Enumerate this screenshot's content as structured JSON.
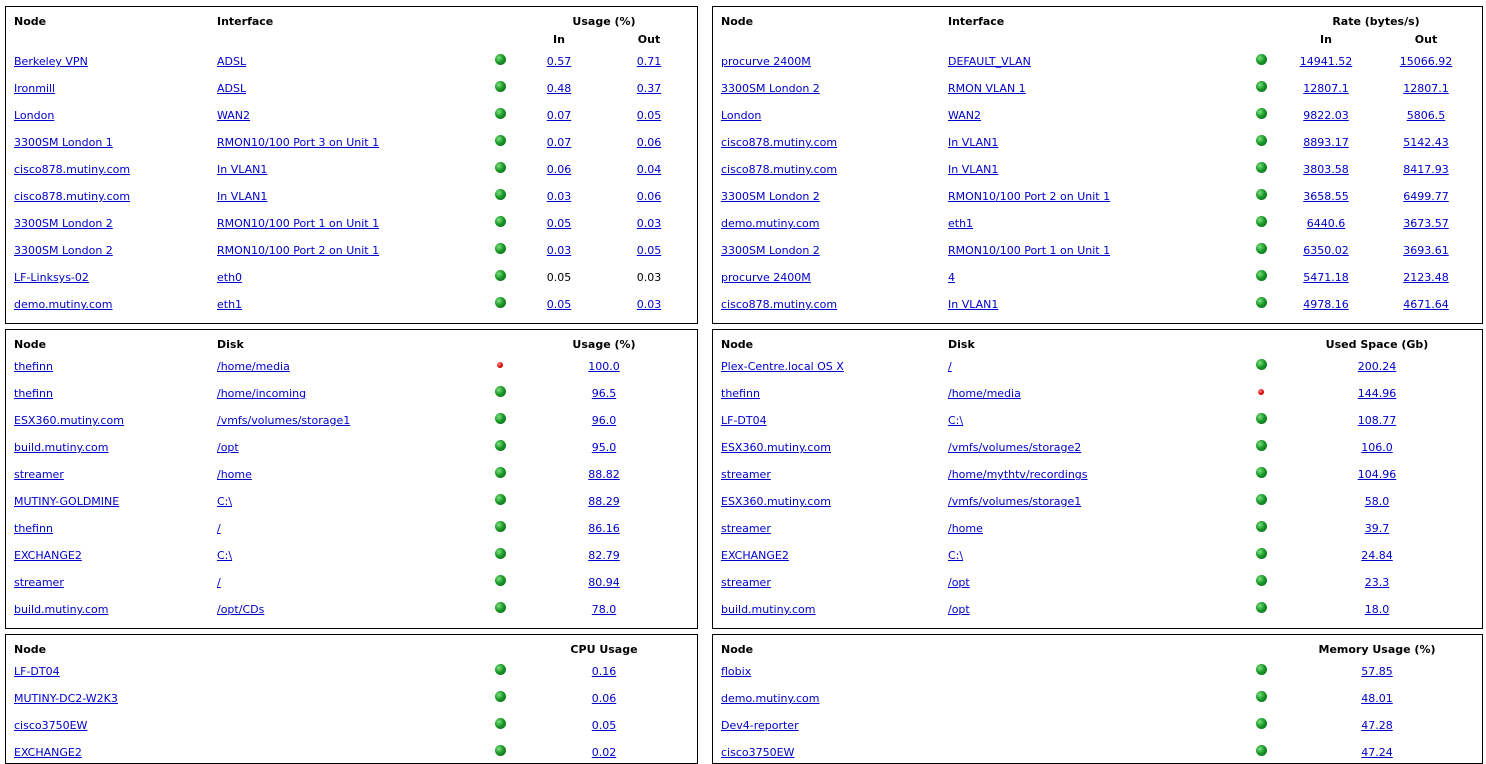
{
  "panels": [
    {
      "id": "interface-usage",
      "headers": {
        "node": "Node",
        "item": "Interface",
        "metric": "Usage (%)",
        "in": "In",
        "out": "Out"
      },
      "rows": [
        {
          "node": "Berkeley VPN",
          "item": "ADSL",
          "status": "ok",
          "in": "0.57",
          "out": "0.71",
          "linked": true
        },
        {
          "node": "Ironmill",
          "item": "ADSL",
          "status": "ok",
          "in": "0.48",
          "out": "0.37",
          "linked": true
        },
        {
          "node": "London",
          "item": "WAN2",
          "status": "ok",
          "in": "0.07",
          "out": "0.05",
          "linked": true
        },
        {
          "node": "3300SM London 1",
          "item": "RMON10/100 Port 3 on Unit 1",
          "status": "ok",
          "in": "0.07",
          "out": "0.06",
          "linked": true
        },
        {
          "node": "cisco878.mutiny.com",
          "item": "In VLAN1",
          "status": "ok",
          "in": "0.06",
          "out": "0.04",
          "linked": true
        },
        {
          "node": "cisco878.mutiny.com",
          "item": "In VLAN1",
          "status": "ok",
          "in": "0.03",
          "out": "0.06",
          "linked": true
        },
        {
          "node": "3300SM London 2",
          "item": "RMON10/100 Port 1 on Unit 1",
          "status": "ok",
          "in": "0.05",
          "out": "0.03",
          "linked": true
        },
        {
          "node": "3300SM London 2",
          "item": "RMON10/100 Port 2 on Unit 1",
          "status": "ok",
          "in": "0.03",
          "out": "0.05",
          "linked": true
        },
        {
          "node": "LF-Linksys-02",
          "item": "eth0",
          "status": "ok",
          "in": "0.05",
          "out": "0.03",
          "linked": false
        },
        {
          "node": "demo.mutiny.com",
          "item": "eth1",
          "status": "ok",
          "in": "0.05",
          "out": "0.03",
          "linked": true
        }
      ]
    },
    {
      "id": "interface-rate",
      "headers": {
        "node": "Node",
        "item": "Interface",
        "metric": "Rate (bytes/s)",
        "in": "In",
        "out": "Out"
      },
      "rows": [
        {
          "node": "procurve 2400M",
          "item": "DEFAULT_VLAN",
          "status": "ok",
          "in": "14941.52",
          "out": "15066.92",
          "linked": true
        },
        {
          "node": "3300SM London 2",
          "item": "RMON VLAN 1",
          "status": "ok",
          "in": "12807.1",
          "out": "12807.1",
          "linked": true
        },
        {
          "node": "London",
          "item": "WAN2",
          "status": "ok",
          "in": "9822.03",
          "out": "5806.5",
          "linked": true
        },
        {
          "node": "cisco878.mutiny.com",
          "item": "In VLAN1",
          "status": "ok",
          "in": "8893.17",
          "out": "5142.43",
          "linked": true
        },
        {
          "node": "cisco878.mutiny.com",
          "item": "In VLAN1",
          "status": "ok",
          "in": "3803.58",
          "out": "8417.93",
          "linked": true
        },
        {
          "node": "3300SM London 2",
          "item": "RMON10/100 Port 2 on Unit 1",
          "status": "ok",
          "in": "3658.55",
          "out": "6499.77",
          "linked": true
        },
        {
          "node": "demo.mutiny.com",
          "item": "eth1",
          "status": "ok",
          "in": "6440.6",
          "out": "3673.57",
          "linked": true
        },
        {
          "node": "3300SM London 2",
          "item": "RMON10/100 Port 1 on Unit 1",
          "status": "ok",
          "in": "6350.02",
          "out": "3693.61",
          "linked": true
        },
        {
          "node": "procurve 2400M",
          "item": "4",
          "status": "ok",
          "in": "5471.18",
          "out": "2123.48",
          "linked": true
        },
        {
          "node": "cisco878.mutiny.com",
          "item": "In VLAN1",
          "status": "ok",
          "in": "4978.16",
          "out": "4671.64",
          "linked": true
        }
      ]
    },
    {
      "id": "disk-usage",
      "headers": {
        "node": "Node",
        "item": "Disk",
        "metric": "Usage (%)"
      },
      "rows": [
        {
          "node": "thefinn",
          "item": "/home/media",
          "status": "alert",
          "value": "100.0"
        },
        {
          "node": "thefinn",
          "item": "/home/incoming",
          "status": "ok",
          "value": "96.5"
        },
        {
          "node": "ESX360.mutiny.com",
          "item": "/vmfs/volumes/storage1",
          "status": "ok",
          "value": "96.0"
        },
        {
          "node": "build.mutiny.com",
          "item": "/opt",
          "status": "ok",
          "value": "95.0"
        },
        {
          "node": "streamer",
          "item": "/home",
          "status": "ok",
          "value": "88.82"
        },
        {
          "node": "MUTINY-GOLDMINE",
          "item": "C:\\",
          "status": "ok",
          "value": "88.29"
        },
        {
          "node": "thefinn",
          "item": "/",
          "status": "ok",
          "value": "86.16"
        },
        {
          "node": "EXCHANGE2",
          "item": "C:\\",
          "status": "ok",
          "value": "82.79"
        },
        {
          "node": "streamer",
          "item": "/",
          "status": "ok",
          "value": "80.94"
        },
        {
          "node": "build.mutiny.com",
          "item": "/opt/CDs",
          "status": "ok",
          "value": "78.0"
        }
      ]
    },
    {
      "id": "disk-space",
      "headers": {
        "node": "Node",
        "item": "Disk",
        "metric": "Used Space (Gb)"
      },
      "rows": [
        {
          "node": "Plex-Centre.local OS X",
          "item": "/",
          "status": "ok",
          "value": "200.24"
        },
        {
          "node": "thefinn",
          "item": "/home/media",
          "status": "alert",
          "value": "144.96"
        },
        {
          "node": "LF-DT04",
          "item": "C:\\",
          "status": "ok",
          "value": "108.77"
        },
        {
          "node": "ESX360.mutiny.com",
          "item": "/vmfs/volumes/storage2",
          "status": "ok",
          "value": "106.0"
        },
        {
          "node": "streamer",
          "item": "/home/mythtv/recordings",
          "status": "ok",
          "value": "104.96"
        },
        {
          "node": "ESX360.mutiny.com",
          "item": "/vmfs/volumes/storage1",
          "status": "ok",
          "value": "58.0"
        },
        {
          "node": "streamer",
          "item": "/home",
          "status": "ok",
          "value": "39.7"
        },
        {
          "node": "EXCHANGE2",
          "item": "C:\\",
          "status": "ok",
          "value": "24.84"
        },
        {
          "node": "streamer",
          "item": "/opt",
          "status": "ok",
          "value": "23.3"
        },
        {
          "node": "build.mutiny.com",
          "item": "/opt",
          "status": "ok",
          "value": "18.0"
        }
      ]
    },
    {
      "id": "cpu-usage",
      "headers": {
        "node": "Node",
        "metric": "CPU Usage"
      },
      "rows": [
        {
          "node": "LF-DT04",
          "status": "ok",
          "value": "0.16"
        },
        {
          "node": "MUTINY-DC2-W2K3",
          "status": "ok",
          "value": "0.06"
        },
        {
          "node": "cisco3750EW",
          "status": "ok",
          "value": "0.05"
        },
        {
          "node": "EXCHANGE2",
          "status": "ok",
          "value": "0.02"
        }
      ]
    },
    {
      "id": "memory-usage",
      "headers": {
        "node": "Node",
        "metric": "Memory Usage (%)"
      },
      "rows": [
        {
          "node": "flobix",
          "status": "ok",
          "value": "57.85"
        },
        {
          "node": "demo.mutiny.com",
          "status": "ok",
          "value": "48.01"
        },
        {
          "node": "Dev4-reporter",
          "status": "ok",
          "value": "47.28"
        },
        {
          "node": "cisco3750EW",
          "status": "ok",
          "value": "47.24"
        }
      ]
    }
  ],
  "colors": {
    "link": "#0000cc",
    "ok": "#1a9a2a",
    "alert": "#e01010"
  }
}
